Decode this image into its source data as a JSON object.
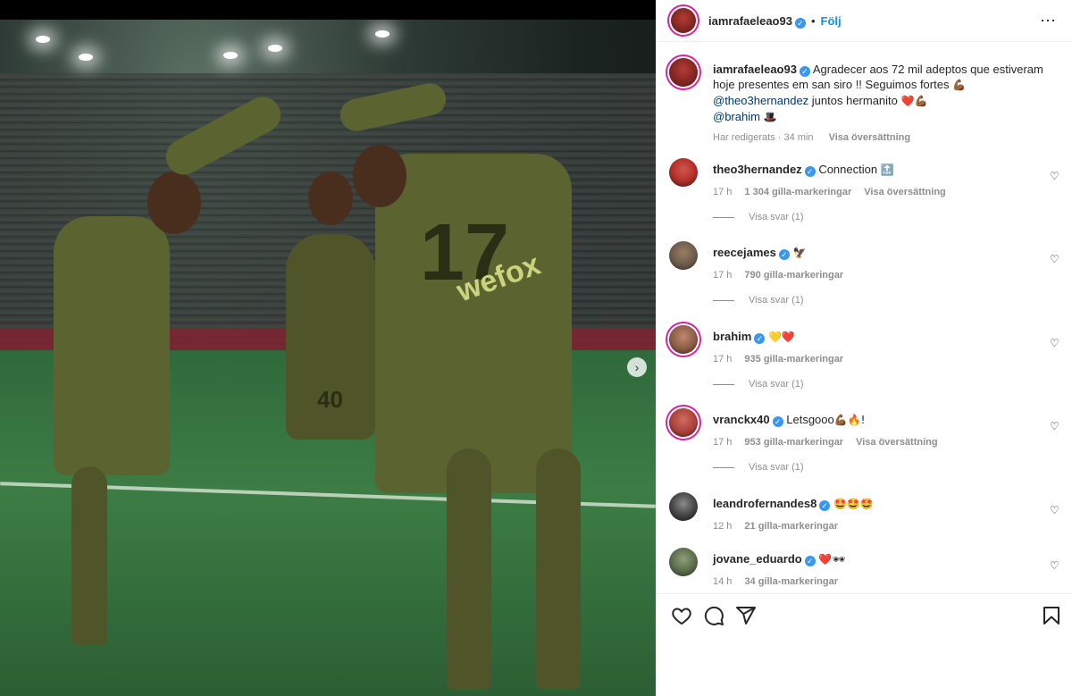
{
  "header": {
    "username": "iamrafaeleao93",
    "separator": "•",
    "follow_label": "Följ",
    "more_icon": "more-icon"
  },
  "caption": {
    "username": "iamrafaeleao93",
    "line1": "Agradecer aos 72 mil adeptos que estiveram",
    "line2": "hoje presentes em san siro !! Seguimos fortes",
    "line2_emoji": "💪🏾",
    "mention1": "@theo3hernandez",
    "line3_rest": " juntos hermanito",
    "line3_emoji": "❤️💪🏾",
    "mention2": "@brahim",
    "line4_emoji": "🎩",
    "edited": "Har redigerats · 34 min",
    "translate": "Visa översättning"
  },
  "comments": [
    {
      "username": "theo3hernandez",
      "text": "Connection",
      "emoji": "🔝",
      "time": "17 h",
      "likes": "1 304 gilla-markeringar",
      "translate": "Visa översättning",
      "replies": "Visa svar (1)",
      "avatar_color": "#b5312b"
    },
    {
      "username": "reecejames",
      "text": "",
      "emoji": "🦅",
      "time": "17 h",
      "likes": "790 gilla-markeringar",
      "translate": "",
      "replies": "Visa svar (1)",
      "avatar_color": "#6b5a4a"
    },
    {
      "username": "brahim",
      "text": "",
      "emoji": "💛❤️",
      "time": "17 h",
      "likes": "935 gilla-markeringar",
      "translate": "",
      "replies": "Visa svar (1)",
      "avatar_color": "#8a5b46"
    },
    {
      "username": "vranckx40",
      "text": "Letsgooo",
      "emoji": "💪🏾🔥!",
      "time": "17 h",
      "likes": "953 gilla-markeringar",
      "translate": "Visa översättning",
      "replies": "Visa svar (1)",
      "avatar_color": "#a9413a"
    },
    {
      "username": "leandrofernandes8",
      "text": "",
      "emoji": "🤩🤩🤩",
      "time": "12 h",
      "likes": "21 gilla-markeringar",
      "translate": "",
      "replies": "",
      "avatar_color": "#3c3c3c"
    },
    {
      "username": "jovane_eduardo",
      "text": "",
      "emoji": "❤️🕶",
      "time": "14 h",
      "likes": "34 gilla-markeringar",
      "translate": "",
      "replies": "",
      "avatar_color": "#5a6b4a"
    }
  ],
  "photo": {
    "jersey_number_front": "40",
    "jersey_number_back": "17",
    "sponsor": "wefox",
    "next_icon": "chevron-right-icon"
  },
  "actions": {
    "like_icon": "heart-icon",
    "comment_icon": "comment-icon",
    "share_icon": "share-icon",
    "save_icon": "bookmark-icon"
  },
  "colors": {
    "accent": "#0095f6",
    "verified": "#3897f0",
    "muted": "#8e8e8e",
    "text": "#262626"
  }
}
